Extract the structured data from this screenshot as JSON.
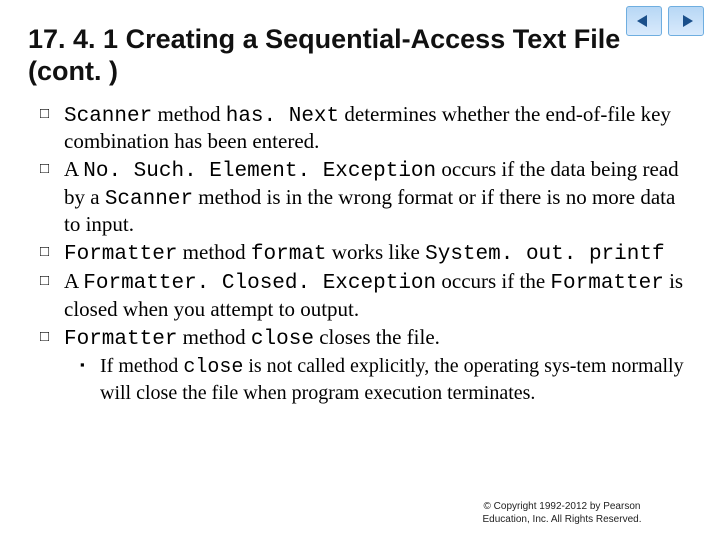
{
  "nav": {
    "prev": "previous-slide",
    "next": "next-slide"
  },
  "heading": "17. 4. 1 Creating a Sequential-Access Text File (cont. )",
  "bullets": [
    {
      "parts": [
        {
          "t": "Scanner",
          "m": true
        },
        {
          "t": " method ",
          "m": false
        },
        {
          "t": "has. Next",
          "m": true
        },
        {
          "t": " determines whether the end-of-file key combination has been entered.",
          "m": false
        }
      ]
    },
    {
      "parts": [
        {
          "t": "A ",
          "m": false
        },
        {
          "t": "No. Such. Element. Exception",
          "m": true
        },
        {
          "t": " occurs if the data being read by a ",
          "m": false
        },
        {
          "t": "Scanner",
          "m": true
        },
        {
          "t": " method is in the wrong format or if there is no more data to input.",
          "m": false
        }
      ]
    },
    {
      "parts": [
        {
          "t": "Formatter",
          "m": true
        },
        {
          "t": " method ",
          "m": false
        },
        {
          "t": "format",
          "m": true
        },
        {
          "t": " works like ",
          "m": false
        },
        {
          "t": "System. out. printf",
          "m": true
        }
      ]
    },
    {
      "parts": [
        {
          "t": "A ",
          "m": false
        },
        {
          "t": "Formatter. Closed. Exception",
          "m": true
        },
        {
          "t": " occurs if the ",
          "m": false
        },
        {
          "t": "Formatter",
          "m": true
        },
        {
          "t": " is closed when you attempt to output.",
          "m": false
        }
      ]
    },
    {
      "parts": [
        {
          "t": "Formatter",
          "m": true
        },
        {
          "t": " method ",
          "m": false
        },
        {
          "t": "close",
          "m": true
        },
        {
          "t": " closes the file.",
          "m": false
        }
      ]
    }
  ],
  "subbullet": {
    "parts": [
      {
        "t": "If method ",
        "m": false
      },
      {
        "t": "close",
        "m": true
      },
      {
        "t": " is not called explicitly, the operating sys-tem normally will close the file when program execution terminates.",
        "m": false
      }
    ]
  },
  "footer1": "© Copyright 1992-2012 by Pearson",
  "footer2": "Education, Inc. All Rights Reserved."
}
